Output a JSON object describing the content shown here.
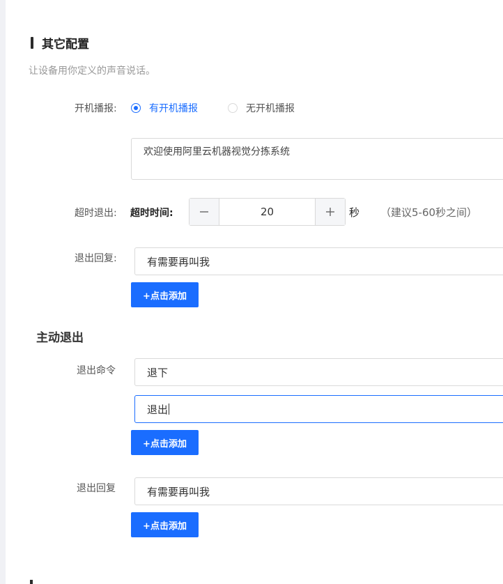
{
  "section": {
    "title": "其它配置",
    "description": "让设备用你定义的声音说话。"
  },
  "boot_broadcast": {
    "label": "开机播报:",
    "options": [
      {
        "label": "有开机播报",
        "selected": true
      },
      {
        "label": "无开机播报",
        "selected": false
      }
    ],
    "message": "欢迎使用阿里云机器视觉分拣系统"
  },
  "timeout_exit": {
    "label": "超时退出:",
    "sub_label": "超时时间:",
    "value": "20",
    "unit": "秒",
    "hint": "（建议5-60秒之间）",
    "minus_icon": "minus-icon",
    "plus_icon": "plus-icon"
  },
  "exit_reply": {
    "label": "退出回复:",
    "values": [
      "有需要再叫我"
    ],
    "add_label": "+点击添加"
  },
  "active_exit": {
    "title": "主动退出",
    "command_label": "退出命令",
    "commands": [
      "退下",
      "退出"
    ],
    "add_command_label": "+点击添加",
    "reply_label": "退出回复",
    "replies": [
      "有需要再叫我"
    ],
    "add_reply_label": "+点击添加"
  },
  "colors": {
    "accent": "#1a6dff",
    "border": "#d9d9d9",
    "muted_text": "#999999"
  }
}
